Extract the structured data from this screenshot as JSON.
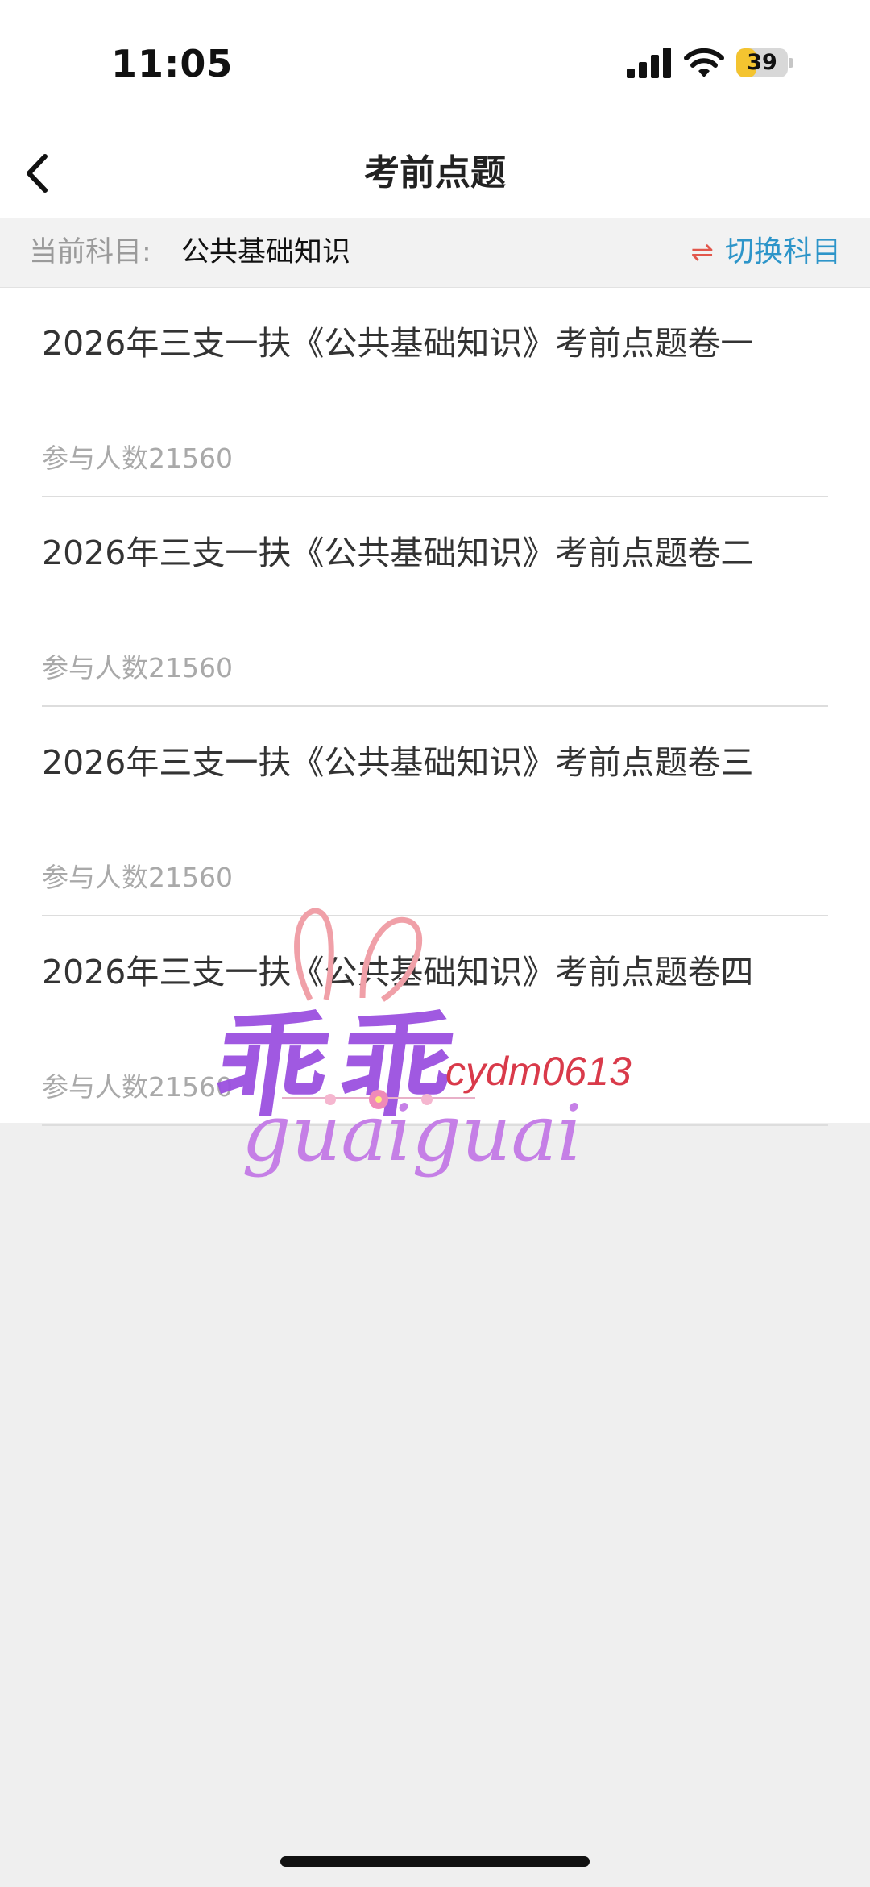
{
  "status_bar": {
    "time": "11:05",
    "battery_level": "39",
    "battery_fraction": 0.39
  },
  "header": {
    "title": "考前点题"
  },
  "subject_bar": {
    "label": "当前科目:",
    "current_subject": "公共基础知识",
    "switch_label": "切换科目",
    "switch_icon": "swap-arrows-icon"
  },
  "papers": [
    {
      "title": "2026年三支一扶《公共基础知识》考前点题卷一",
      "participants": "参与人数21560"
    },
    {
      "title": "2026年三支一扶《公共基础知识》考前点题卷二",
      "participants": "参与人数21560"
    },
    {
      "title": "2026年三支一扶《公共基础知识》考前点题卷三",
      "participants": "参与人数21560"
    },
    {
      "title": "2026年三支一扶《公共基础知识》考前点题卷四",
      "participants": "参与人数21560"
    }
  ],
  "watermark": {
    "chars": "乖乖",
    "cursive": "guaiguai",
    "handle": "cydm0613"
  },
  "colors": {
    "accent": "#2d95c9",
    "switch_icon": "#e2574c",
    "battery": "#f4c430"
  }
}
